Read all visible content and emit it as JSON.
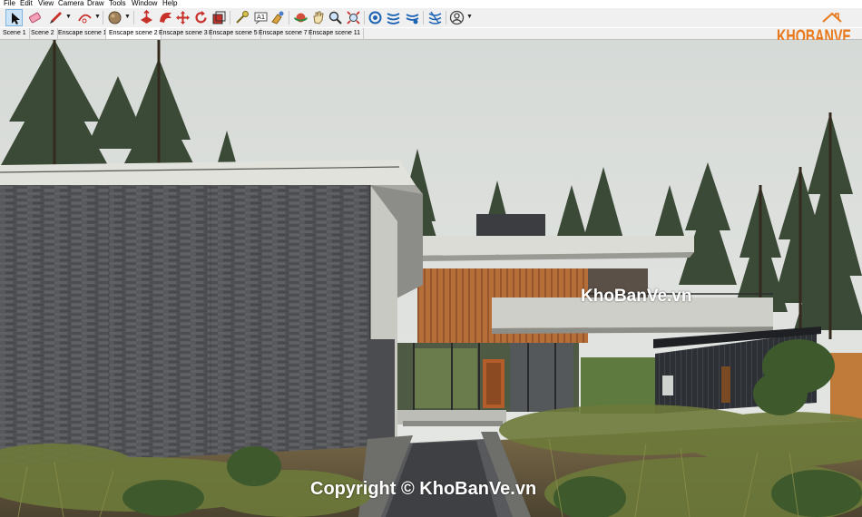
{
  "menu": [
    "File",
    "Edit",
    "View",
    "Camera",
    "Draw",
    "Tools",
    "Window",
    "Help"
  ],
  "toolbar": {
    "tools": [
      "select-icon",
      "eraser-icon",
      "pencil-line-icon",
      "arc-icon",
      "paint-bucket-icon",
      "push-pull-icon",
      "follow-me-icon",
      "move-icon",
      "rotate-icon",
      "scale-icon",
      "tape-measure-icon",
      "text-icon",
      "paint-icon",
      "orbit-icon",
      "pan-icon",
      "zoom-icon",
      "zoom-extents-icon",
      "enscape-start-icon",
      "enscape-sync-icon",
      "enscape-capture-icon",
      "enscape-settings-icon",
      "user-icon"
    ]
  },
  "scene_tabs": [
    "Scene 1",
    "Scene 2",
    "Enscape scene 1",
    "Enscape scene 2",
    "Enscape scene 3",
    "Enscape scene 5",
    "Enscape scene 7",
    "Enscape scene 11"
  ],
  "active_scene": "Enscape scene 2",
  "logo": {
    "text": "KHOBANVE",
    "color": "#e8791c"
  },
  "watermarks": {
    "center": "KhoBanVe.vn",
    "bottom": "Copyright © KhoBanVe.vn"
  }
}
